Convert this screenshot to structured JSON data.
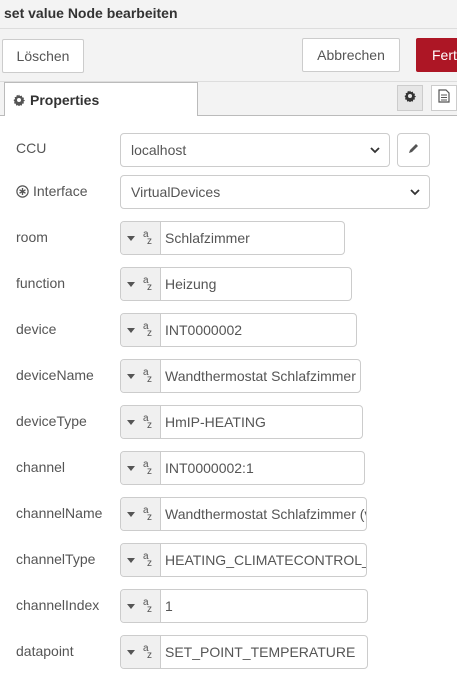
{
  "dialog": {
    "title": "set value Node bearbeiten"
  },
  "toolbar": {
    "delete_label": "Löschen",
    "cancel_label": "Abbrechen",
    "done_label": "Fertig"
  },
  "tabs": {
    "properties_label": "Properties"
  },
  "form": {
    "ccu": {
      "label": "CCU",
      "value": "localhost"
    },
    "interface": {
      "label": "Interface",
      "value": "VirtualDevices"
    },
    "fields": [
      {
        "label": "room",
        "value": "Schlafzimmer"
      },
      {
        "label": "function",
        "value": "Heizung"
      },
      {
        "label": "device",
        "value": "INT0000002"
      },
      {
        "label": "deviceName",
        "value": "Wandthermostat Schlafzimmer"
      },
      {
        "label": "deviceType",
        "value": "HmIP-HEATING"
      },
      {
        "label": "channel",
        "value": "INT0000002:1"
      },
      {
        "label": "channelName",
        "value": "Wandthermostat Schlafzimmer (v"
      },
      {
        "label": "channelType",
        "value": "HEATING_CLIMATECONTROL_"
      },
      {
        "label": "channelIndex",
        "value": "1"
      },
      {
        "label": "datapoint",
        "value": "SET_POINT_TEMPERATURE"
      }
    ]
  }
}
